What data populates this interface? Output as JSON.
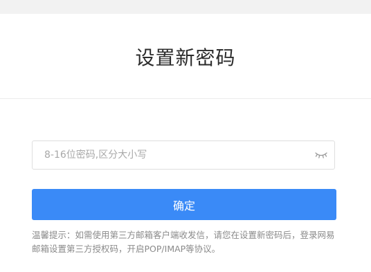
{
  "page": {
    "title": "设置新密码"
  },
  "password_field": {
    "placeholder": "8-16位密码,区分大小写",
    "value": "",
    "toggle_icon": "eye-closed-icon"
  },
  "confirm_button": {
    "label": "确定",
    "color": "#3a8af7"
  },
  "tip": {
    "text": "温馨提示：如需使用第三方邮箱客户端收发信，请您在设置新密码后，登录网易邮箱设置第三方授权码，开启POP/IMAP等协议。"
  }
}
